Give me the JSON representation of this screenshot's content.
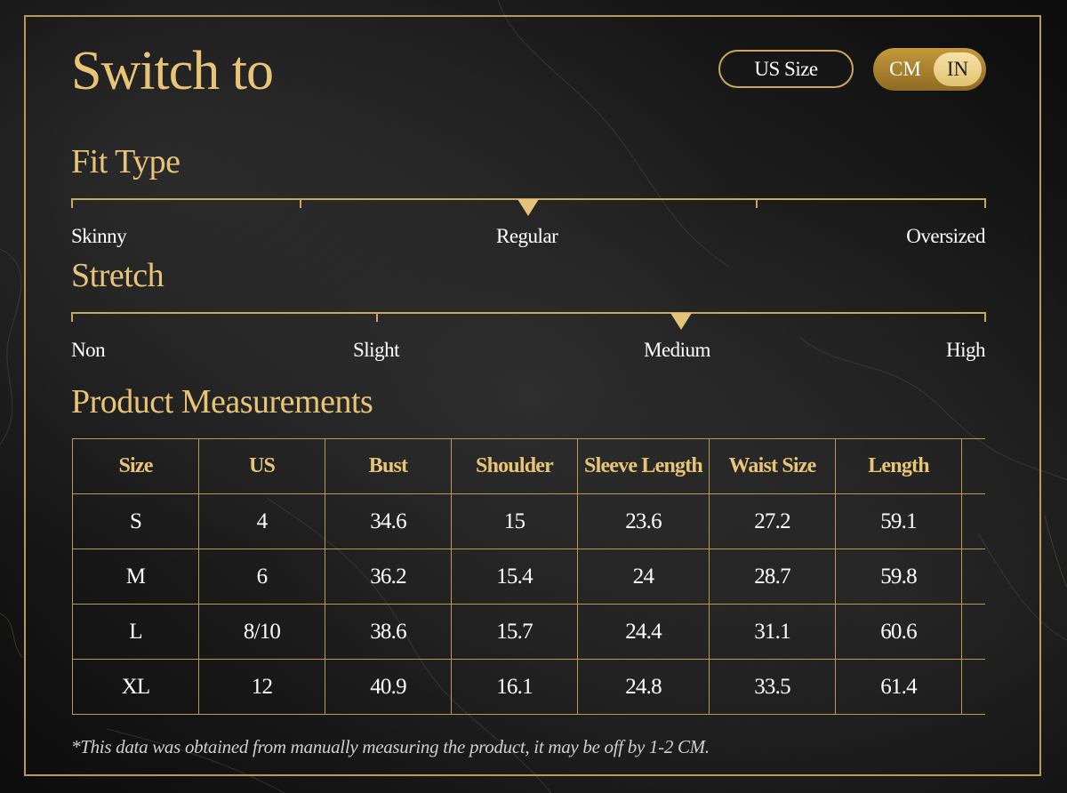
{
  "header": {
    "title": "Switch to",
    "size_system_label": "US Size",
    "units": {
      "options": [
        "CM",
        "IN"
      ],
      "selected": "IN"
    }
  },
  "fit_type": {
    "heading": "Fit Type",
    "labels": [
      "Skinny",
      "Regular",
      "Oversized"
    ],
    "selected": "Regular"
  },
  "stretch": {
    "heading": "Stretch",
    "labels": [
      "Non",
      "Slight",
      "Medium",
      "High"
    ],
    "selected": "Medium"
  },
  "measurements": {
    "heading": "Product Measurements",
    "columns": [
      "Size",
      "US",
      "Bust",
      "Shoulder",
      "Sleeve Length",
      "Waist Size",
      "Length"
    ],
    "rows": [
      [
        "S",
        "4",
        "34.6",
        "15",
        "23.6",
        "27.2",
        "59.1"
      ],
      [
        "M",
        "6",
        "36.2",
        "15.4",
        "24",
        "28.7",
        "59.8"
      ],
      [
        "L",
        "8/10",
        "38.6",
        "15.7",
        "24.4",
        "31.1",
        "60.6"
      ],
      [
        "XL",
        "12",
        "40.9",
        "16.1",
        "24.8",
        "33.5",
        "61.4"
      ]
    ],
    "footnote": "*This data was obtained from manually measuring the product, it may be off by 1-2 CM."
  },
  "colors": {
    "accent_gold": "#e8c476",
    "border_gold": "#c9a760",
    "background": "#1a1a1a",
    "text": "#ffffff"
  }
}
